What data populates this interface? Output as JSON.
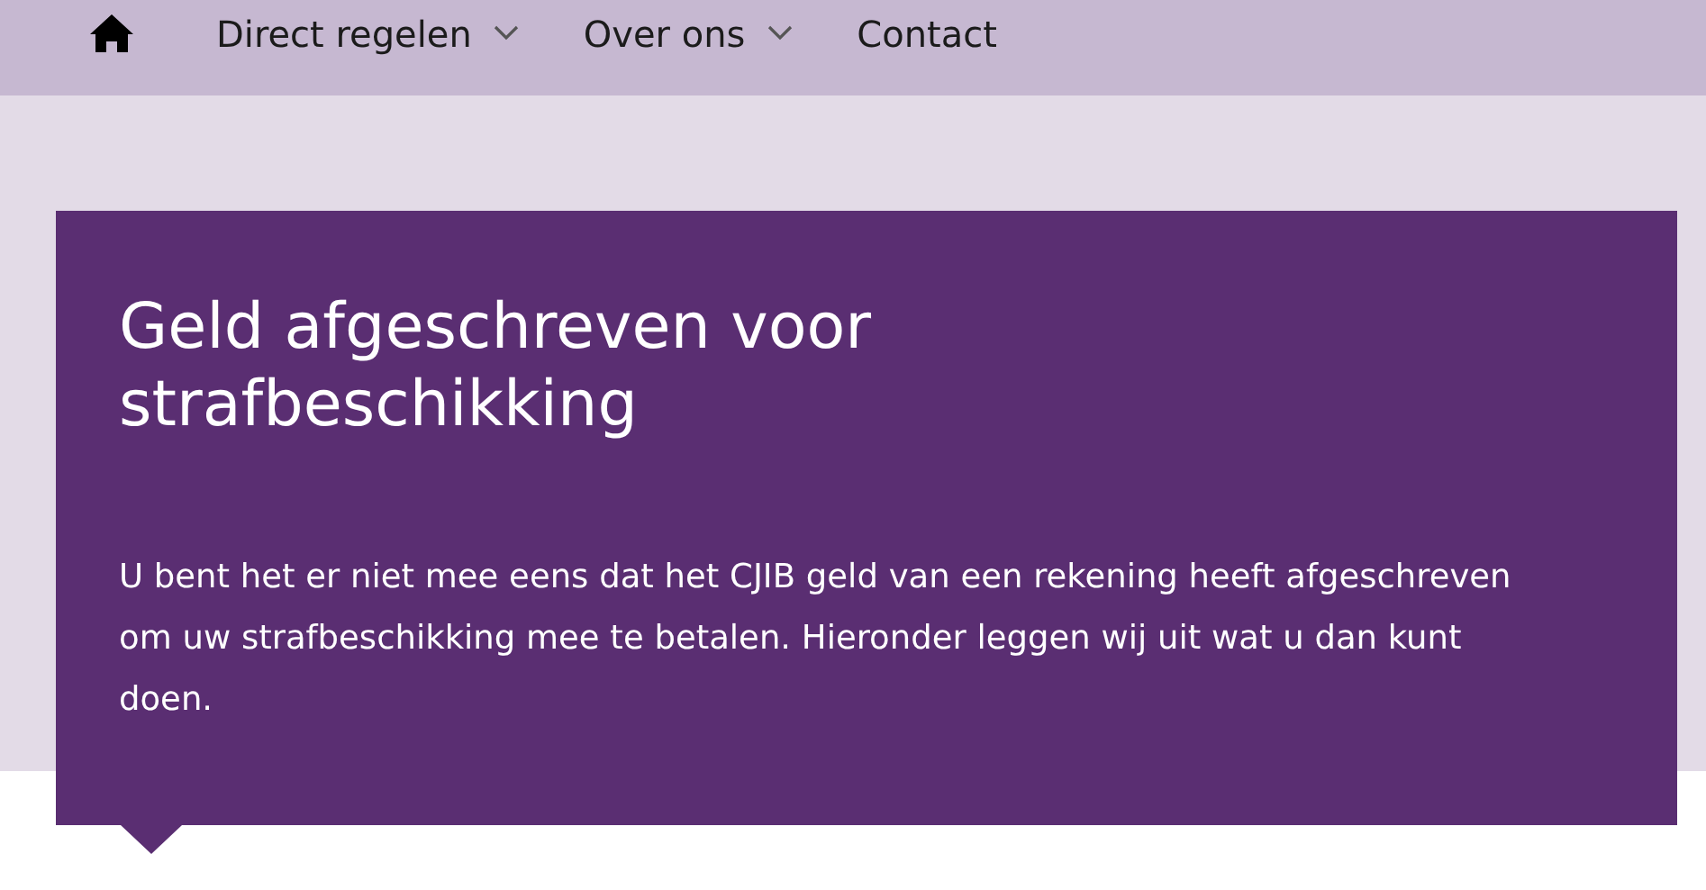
{
  "nav": {
    "items": [
      {
        "kind": "home"
      },
      {
        "kind": "menu",
        "label": "Direct regelen"
      },
      {
        "kind": "menu",
        "label": "Over ons"
      },
      {
        "kind": "link",
        "label": "Contact"
      }
    ]
  },
  "hero": {
    "title": "Geld afgeschreven voor strafbeschikking",
    "text": "U bent het er niet mee eens dat het CJIB geld van een rekening heeft afgeschreven om uw strafbeschikking mee te betalen. Hieronder leggen wij uit wat u dan kunt doen."
  }
}
